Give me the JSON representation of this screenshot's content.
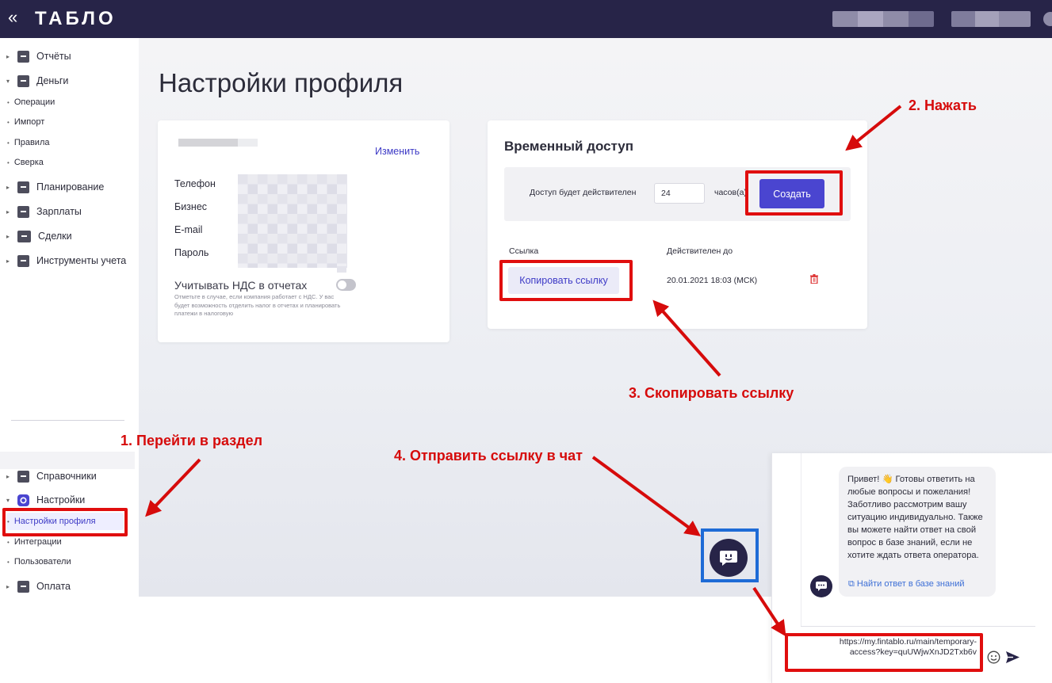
{
  "header": {
    "collapse_glyph": "«",
    "logo": "ТАБЛО"
  },
  "sidebar": {
    "items": [
      {
        "label": "Отчёты",
        "icon": "chart-icon"
      },
      {
        "label": "Деньги",
        "icon": "wallet-icon"
      },
      {
        "label": "Планирование",
        "icon": "checklist-icon"
      },
      {
        "label": "Зарплаты",
        "icon": "person-badge-icon"
      },
      {
        "label": "Сделки",
        "icon": "briefcase-icon"
      },
      {
        "label": "Инструменты учета",
        "icon": "tools-icon"
      },
      {
        "label": "Справочники",
        "icon": "book-icon"
      },
      {
        "label": "Настройки",
        "icon": "gear-icon"
      },
      {
        "label": "Оплата",
        "icon": "card-icon"
      }
    ],
    "money_sub": [
      "Операции",
      "Импорт",
      "Правила",
      "Сверка"
    ],
    "settings_sub": [
      "Настройки профиля",
      "Интеграции",
      "Пользователи"
    ]
  },
  "page": {
    "title": "Настройки профиля"
  },
  "profile_card": {
    "edit_label": "Изменить",
    "fields": [
      "Телефон",
      "Бизнес",
      "E-mail",
      "Пароль"
    ],
    "nds_label": "Учитывать НДС в отчетах",
    "nds_enabled": false,
    "nds_hint": "Отметьте в случае, если компания работает с НДС. У вас будет возможность отделить налог в отчетах и планировать платежи в налоговую"
  },
  "access_card": {
    "title": "Временный доступ",
    "valid_label": "Доступ будет действителен",
    "hours_value": "24",
    "hours_unit": "часов(а)",
    "create_label": "Создать",
    "col_link": "Ссылка",
    "col_valid": "Действителен до",
    "copy_label": "Копировать ссылку",
    "valid_until": "20.01.2021 18:03 (МСК)"
  },
  "annotations": {
    "step1": "1. Перейти в раздел",
    "step2": "2. Нажать",
    "step3": "3. Скопировать ссылку",
    "step4": "4. Отправить ссылку в чат",
    "color_red": "#e00e0e",
    "color_blue": "#1e6bd6"
  },
  "chat": {
    "greeting": "Привет! 👋 Готовы ответить на любые вопросы и пожелания! Заботливо рассмотрим вашу ситуацию индивидуально. Также вы можете найти ответ на свой вопрос в базе знаний, если не хотите ждать ответа оператора.",
    "kb_link": "Найти ответ в базе знаний",
    "input_line1": "https://my.fintablo.ru/main/temporary-",
    "input_line2": "access?key=quUWjwXnJD2Txb6v"
  },
  "colors": {
    "brand": "#272448",
    "accent": "#4a45d0",
    "danger": "#d60b0b"
  }
}
